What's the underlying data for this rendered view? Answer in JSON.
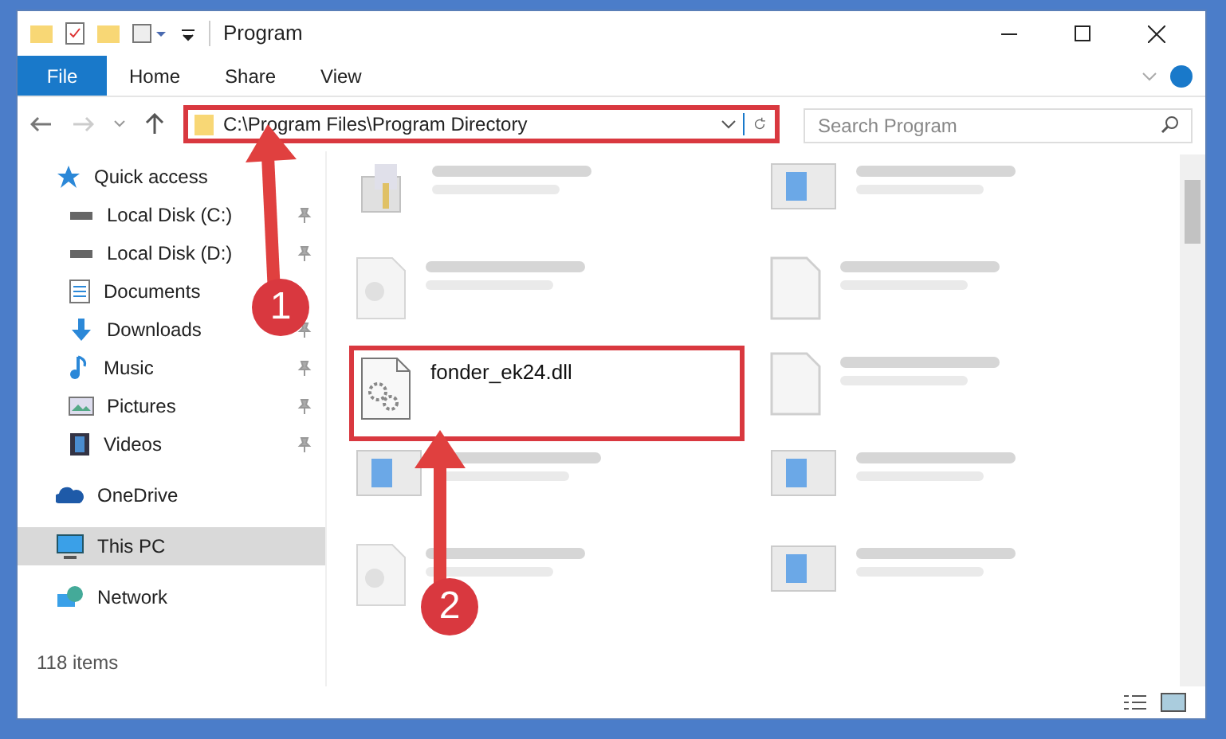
{
  "window": {
    "title": "Program"
  },
  "ribbon": {
    "tabs": [
      {
        "label": "File",
        "selected": true
      },
      {
        "label": "Home",
        "selected": false
      },
      {
        "label": "Share",
        "selected": false
      },
      {
        "label": "View",
        "selected": false
      }
    ]
  },
  "address": {
    "path": "C:\\Program Files\\Program Directory",
    "highlighted": true
  },
  "search": {
    "placeholder": "Search Program"
  },
  "sidebar": {
    "items": [
      {
        "label": "Quick access",
        "kind": "star",
        "selected": false,
        "pinned": false,
        "children": [
          {
            "label": "Local Disk (C:)",
            "kind": "disk",
            "selected": false,
            "pinned": true
          },
          {
            "label": "Local Disk (D:)",
            "kind": "disk",
            "selected": false,
            "pinned": true
          },
          {
            "label": "Documents",
            "kind": "doc",
            "selected": false,
            "pinned": false
          },
          {
            "label": "Downloads",
            "kind": "download",
            "selected": false,
            "pinned": true
          },
          {
            "label": "Music",
            "kind": "music",
            "selected": false,
            "pinned": true
          },
          {
            "label": "Pictures",
            "kind": "pictures",
            "selected": false,
            "pinned": true
          },
          {
            "label": "Videos",
            "kind": "video",
            "selected": false,
            "pinned": true
          }
        ]
      },
      {
        "label": "OneDrive",
        "kind": "cloud",
        "selected": false,
        "pinned": false
      },
      {
        "label": "This PC",
        "kind": "pc",
        "selected": true,
        "pinned": false
      },
      {
        "label": "Network",
        "kind": "network",
        "selected": false,
        "pinned": false
      }
    ]
  },
  "files": [
    {
      "kind": "setup",
      "blurred": true,
      "highlighted": false
    },
    {
      "kind": "app",
      "blurred": true,
      "highlighted": false
    },
    {
      "kind": "dll",
      "blurred": true,
      "highlighted": false
    },
    {
      "kind": "blank",
      "blurred": true,
      "highlighted": false
    },
    {
      "name": "fonder_ek24.dll",
      "kind": "gears",
      "blurred": false,
      "highlighted": true
    },
    {
      "kind": "blank",
      "blurred": true,
      "highlighted": false
    },
    {
      "kind": "app",
      "blurred": true,
      "highlighted": false
    },
    {
      "kind": "app",
      "blurred": true,
      "highlighted": false
    },
    {
      "kind": "dll",
      "blurred": true,
      "highlighted": false
    },
    {
      "kind": "app",
      "blurred": true,
      "highlighted": false
    }
  ],
  "status_bar": {
    "count": "118 items"
  },
  "annotations": [
    {
      "label": "1"
    },
    {
      "label": "2"
    }
  ]
}
